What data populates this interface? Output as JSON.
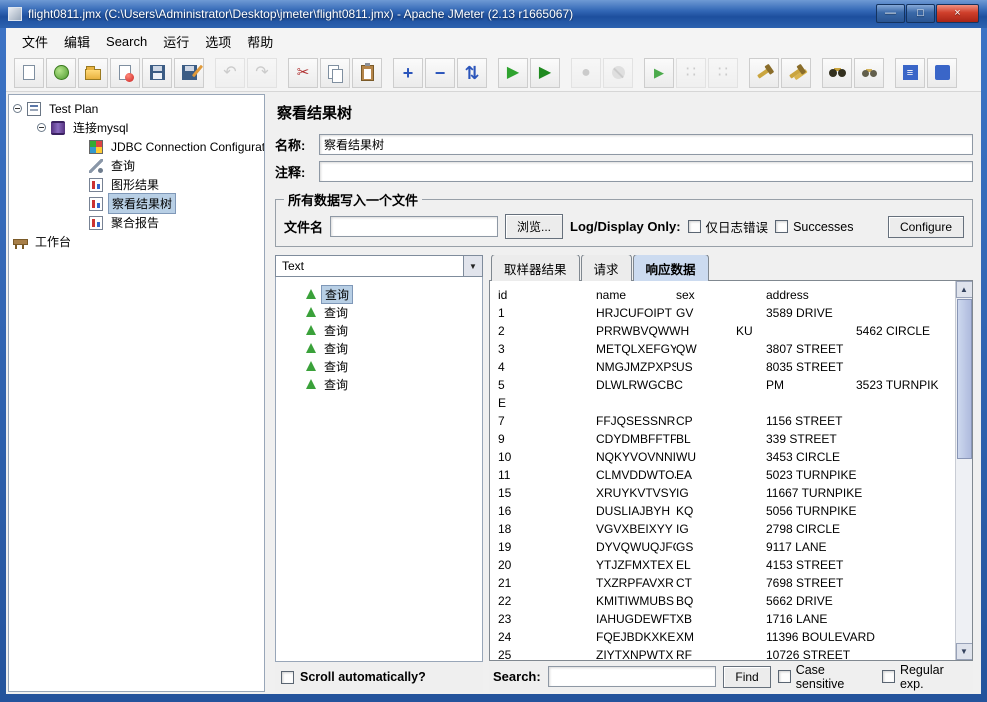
{
  "window": {
    "title": "flight0811.jmx (C:\\Users\\Administrator\\Desktop\\jmeter\\flight0811.jmx) - Apache JMeter (2.13 r1665067)"
  },
  "icons": {
    "minimize": "—",
    "maximize": "□",
    "close": "×",
    "combo_arrow": "▼",
    "scroll_up": "▲",
    "scroll_down": "▼"
  },
  "menu": {
    "items": [
      "文件",
      "编辑",
      "Search",
      "运行",
      "选项",
      "帮助"
    ]
  },
  "toolbar": {
    "buttons": [
      {
        "id": "new",
        "icon": "page"
      },
      {
        "id": "templates",
        "icon": "globe"
      },
      {
        "id": "open",
        "icon": "folder"
      },
      {
        "id": "close-file",
        "icon": "page-red"
      },
      {
        "id": "save",
        "icon": "floppy"
      },
      {
        "id": "save-as",
        "icon": "floppy-pencil"
      },
      {
        "sep": true
      },
      {
        "id": "undo",
        "icon": "glyph",
        "ch": "↶",
        "cls": "g-gray",
        "disabled": true
      },
      {
        "id": "redo",
        "icon": "glyph",
        "ch": "↷",
        "cls": "g-gray",
        "disabled": true
      },
      {
        "sep": true
      },
      {
        "id": "cut",
        "icon": "glyph",
        "ch": "✂",
        "cls": "g-cut"
      },
      {
        "id": "copy",
        "icon": "copy"
      },
      {
        "id": "paste",
        "icon": "paste"
      },
      {
        "sep": true
      },
      {
        "id": "expand-all",
        "icon": "glyph",
        "ch": "+",
        "cls": "g-blue"
      },
      {
        "id": "collapse-all",
        "icon": "glyph",
        "ch": "−",
        "cls": "g-blue"
      },
      {
        "id": "toggle",
        "icon": "glyph",
        "ch": "⇅",
        "cls": "g-blue"
      },
      {
        "sep": true
      },
      {
        "id": "start",
        "icon": "glyph",
        "ch": "▶",
        "cls": "g-green"
      },
      {
        "id": "start-no-pauses",
        "icon": "glyph",
        "ch": "▶",
        "cls": "g-green2"
      },
      {
        "sep": true
      },
      {
        "id": "stop",
        "icon": "glyph",
        "ch": "●",
        "cls": "g-gray",
        "disabled": true
      },
      {
        "id": "shutdown",
        "icon": "circle-slash",
        "disabled": true
      },
      {
        "sep": true
      },
      {
        "id": "remote-start-all",
        "icon": "glyph",
        "ch": "▶",
        "cls": "g-green-sm"
      },
      {
        "id": "remote-stop-all",
        "icon": "glyph",
        "ch": "∷",
        "cls": "g-gray",
        "disabled": true
      },
      {
        "id": "remote-shutdown-all",
        "icon": "glyph",
        "ch": "∷",
        "cls": "g-gray",
        "disabled": true
      },
      {
        "sep": true
      },
      {
        "id": "clear",
        "icon": "hammer"
      },
      {
        "id": "clear-all",
        "icon": "hammer2"
      },
      {
        "sep": true
      },
      {
        "id": "search",
        "icon": "binoculars"
      },
      {
        "id": "search-reset",
        "icon": "binoculars-clear"
      },
      {
        "sep": true
      },
      {
        "id": "function-helper",
        "icon": "fx"
      },
      {
        "id": "help",
        "icon": "help"
      }
    ]
  },
  "tree": {
    "items": [
      {
        "id": "test-plan",
        "label": "Test Plan",
        "icon": "plan",
        "level": 0,
        "knob": true
      },
      {
        "id": "thread-group-mysql",
        "label": "连接mysql",
        "icon": "thread",
        "level": 1,
        "knob": true
      },
      {
        "id": "jdbc-connection-configuration",
        "label": "JDBC Connection Configuration",
        "icon": "jdbc",
        "level": 2
      },
      {
        "id": "jdbc-request-query",
        "label": "查询",
        "icon": "sampler",
        "level": 2
      },
      {
        "id": "graph-results",
        "label": "图形结果",
        "icon": "listener",
        "level": 2
      },
      {
        "id": "view-results-tree",
        "label": "察看结果树",
        "icon": "listener",
        "level": 2,
        "selected": true
      },
      {
        "id": "aggregate-report",
        "label": "聚合报告",
        "icon": "listener",
        "level": 2
      },
      {
        "id": "workbench",
        "label": "工作台",
        "icon": "workbench",
        "level": 0
      }
    ]
  },
  "form": {
    "title": "察看结果树",
    "name_label": "名称:",
    "name_value": "察看结果树",
    "comments_label": "注释:",
    "comments_value": "",
    "file_box": {
      "legend": "所有数据写入一个文件",
      "filename_label": "文件名",
      "filename_value": "",
      "browse": "浏览...",
      "log_display": "Log/Display Only:",
      "errors": "仅日志错误",
      "successes": "Successes",
      "configure": "Configure"
    }
  },
  "results_panel": {
    "view_selector": "Text",
    "items": [
      {
        "label": "查询",
        "selected": true
      },
      {
        "label": "查询"
      },
      {
        "label": "查询"
      },
      {
        "label": "查询"
      },
      {
        "label": "查询"
      },
      {
        "label": "查询"
      }
    ],
    "scroll_label": "Scroll automatically?"
  },
  "tabs": [
    {
      "id": "sampler-result",
      "label": "取样器结果"
    },
    {
      "id": "request",
      "label": "请求"
    },
    {
      "id": "response-data",
      "label": "响应数据",
      "active": true
    }
  ],
  "response": {
    "columns": [
      "id",
      "name",
      "sex",
      "address"
    ],
    "rows": [
      {
        "c": [
          "1",
          "HRJCUFOIPT",
          "GV",
          "3589 DRIVE"
        ]
      },
      {
        "c": [
          "2",
          "PRRWBVQWWH",
          "KU",
          "5462 CIRCLE"
        ],
        "v": 1
      },
      {
        "c": [
          "3",
          "METQLXEFGY",
          "QW",
          "3807 STREET"
        ]
      },
      {
        "c": [
          "4",
          "NMGJMZPXPS",
          "US",
          "8035 STREET"
        ]
      },
      {
        "c": [
          "5",
          "DLWLRWGCBC",
          "PM",
          "3523 TURNPIK"
        ],
        "v": 2
      },
      {
        "c": [
          "E"
        ]
      },
      {
        "c": [
          "7",
          "FFJQSESSNR",
          "CP",
          "1156 STREET"
        ]
      },
      {
        "c": [
          "9",
          "CDYDMBFFTP",
          "BL",
          "339 STREET"
        ]
      },
      {
        "c": [
          "10",
          "NQKYVOVNNI",
          "WU",
          "3453 CIRCLE"
        ]
      },
      {
        "c": [
          "11",
          "CLMVDDWTOJ",
          "EA",
          "5023 TURNPIKE"
        ]
      },
      {
        "c": [
          "15",
          "XRUYKVTVSY",
          "IG",
          "11667 TURNPIKE"
        ]
      },
      {
        "c": [
          "16",
          "DUSLIAJBYH",
          "KQ",
          "5056 TURNPIKE"
        ]
      },
      {
        "c": [
          "18",
          "VGVXBEIXYY",
          "IG",
          "2798 CIRCLE"
        ]
      },
      {
        "c": [
          "19",
          "DYVQWUQJFG",
          "GS",
          "9117 LANE"
        ]
      },
      {
        "c": [
          "20",
          "YTJZFMXTEX",
          "EL",
          "4153 STREET"
        ]
      },
      {
        "c": [
          "21",
          "TXZRPFAVXR",
          "CT",
          "7698 STREET"
        ]
      },
      {
        "c": [
          "22",
          "KMITIWMUBS",
          "BQ",
          "5662 DRIVE"
        ]
      },
      {
        "c": [
          "23",
          "IAHUGDEWFT",
          "XB",
          "1716 LANE"
        ]
      },
      {
        "c": [
          "24",
          "FQEJBDKXKE",
          "XM",
          "11396 BOULEVARD"
        ]
      },
      {
        "c": [
          "25",
          "ZIYTXNPWTX",
          "RF",
          "10726 STREET"
        ]
      }
    ]
  },
  "search_bar": {
    "label": "Search:",
    "value": "",
    "find": "Find",
    "case": "Case sensitive",
    "regex": "Regular exp."
  },
  "colors": {
    "selection": "#b8cfe5",
    "titlebar": "#2c62b0",
    "tab_active": "#ccdbf0"
  }
}
